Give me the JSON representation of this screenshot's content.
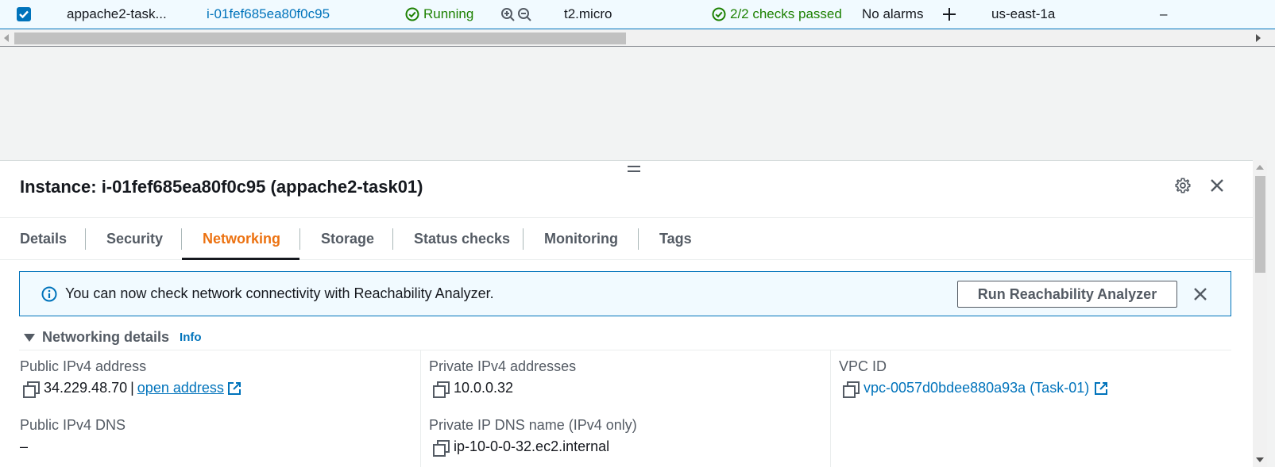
{
  "instance_row": {
    "name": "appache2-task...",
    "instance_id": "i-01fef685ea80f0c95",
    "state": "Running",
    "instance_type": "t2.micro",
    "status_check": "2/2 checks passed",
    "alarm_status": "No alarms",
    "add_alarm": "+",
    "availability_zone": "us-east-1a",
    "public_dns": "–"
  },
  "panel": {
    "title": "Instance: i-01fef685ea80f0c95 (appache2-task01)",
    "tabs": [
      {
        "label": "Details"
      },
      {
        "label": "Security"
      },
      {
        "label": "Networking"
      },
      {
        "label": "Storage"
      },
      {
        "label": "Status checks"
      },
      {
        "label": "Monitoring"
      },
      {
        "label": "Tags"
      }
    ],
    "active_tab": "Networking"
  },
  "flash": {
    "message": "You can now check network connectivity with Reachability Analyzer.",
    "button_label": "Run Reachability Analyzer"
  },
  "networking": {
    "section_title": "Networking details",
    "info_label": "Info",
    "public_ipv4_label": "Public IPv4 address",
    "public_ipv4_value": "34.229.48.70",
    "separator": "|",
    "open_address_label": "open address",
    "private_ipv4_label": "Private IPv4 addresses",
    "private_ipv4_value": "10.0.0.32",
    "vpc_label": "VPC ID",
    "vpc_value": "vpc-0057d0bdee880a93a (Task-01)",
    "public_dns_label": "Public IPv4 DNS",
    "public_dns_value": "–",
    "private_dns_label": "Private IP DNS name (IPv4 only)",
    "private_dns_value": "ip-10-0-0-32.ec2.internal"
  },
  "colors": {
    "link": "#0073bb",
    "success": "#1d8102",
    "active_tab": "#ec7211"
  },
  "icons": [
    "check-icon",
    "status-ok-icon",
    "zoom-in-icon",
    "zoom-out-icon",
    "plus-icon",
    "gear-icon",
    "close-icon",
    "info-icon",
    "copy-icon",
    "external-link-icon"
  ]
}
